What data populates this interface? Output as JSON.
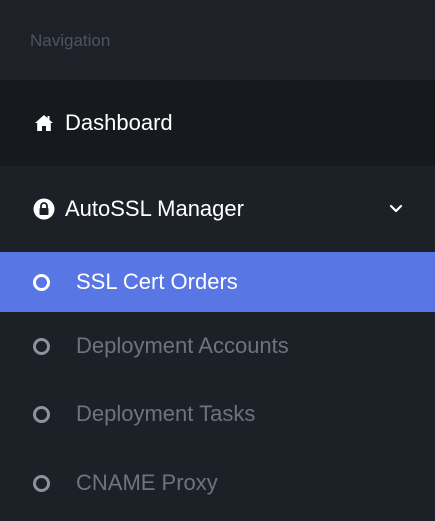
{
  "sidebar": {
    "header": "Navigation",
    "items": [
      {
        "label": "Dashboard",
        "icon": "home-icon"
      },
      {
        "label": "AutoSSL Manager",
        "icon": "lock-icon",
        "expanded": true
      }
    ],
    "submenu": [
      {
        "label": "SSL Cert Orders",
        "active": true
      },
      {
        "label": "Deployment Accounts",
        "active": false
      },
      {
        "label": "Deployment Tasks",
        "active": false
      },
      {
        "label": "CNAME Proxy",
        "active": false
      }
    ]
  },
  "colors": {
    "sidebar_bg": "#1c2127",
    "active_bg": "#5876e4",
    "muted_text": "#6b757f",
    "header_text": "#495560"
  }
}
